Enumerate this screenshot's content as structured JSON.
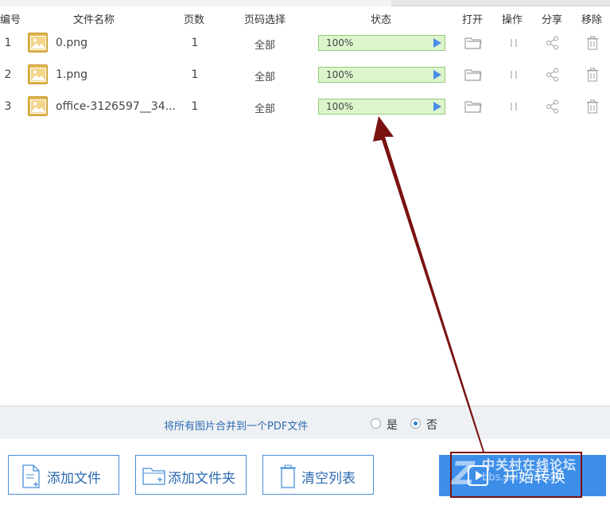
{
  "columns": {
    "num": "编号",
    "name": "文件名称",
    "pages": "页数",
    "range": "页码选择",
    "status": "状态",
    "open": "打开",
    "action": "操作",
    "share": "分享",
    "remove": "移除"
  },
  "files": [
    {
      "num": "1",
      "name": "0.png",
      "pages": "1",
      "range": "全部",
      "progress_text": "100%",
      "progress": 1.0
    },
    {
      "num": "2",
      "name": "1.png",
      "pages": "1",
      "range": "全部",
      "progress_text": "100%",
      "progress": 1.0
    },
    {
      "num": "3",
      "name": "office-3126597__34...",
      "pages": "1",
      "range": "全部",
      "progress_text": "100%",
      "progress": 1.0
    }
  ],
  "merge": {
    "label": "将所有图片合并到一个PDF文件",
    "yes": "是",
    "no": "否",
    "selected": "no"
  },
  "buttons": {
    "add_file": "添加文件",
    "add_folder": "添加文件夹",
    "clear_list": "清空列表",
    "start": "开始转换"
  },
  "watermark": {
    "mark": "Z",
    "title": "中关村在线论坛",
    "subtitle": "bbs.zol.com.cn"
  },
  "colors": {
    "accent": "#3d8ee8",
    "progress_fill": "#ddf5cc",
    "annotation": "#7a1212"
  },
  "icons": [
    "image-file-icon",
    "folder-open-icon",
    "pause-icon",
    "share-icon",
    "trash-icon",
    "add-file-icon",
    "add-folder-icon",
    "clear-list-icon",
    "play-icon"
  ]
}
